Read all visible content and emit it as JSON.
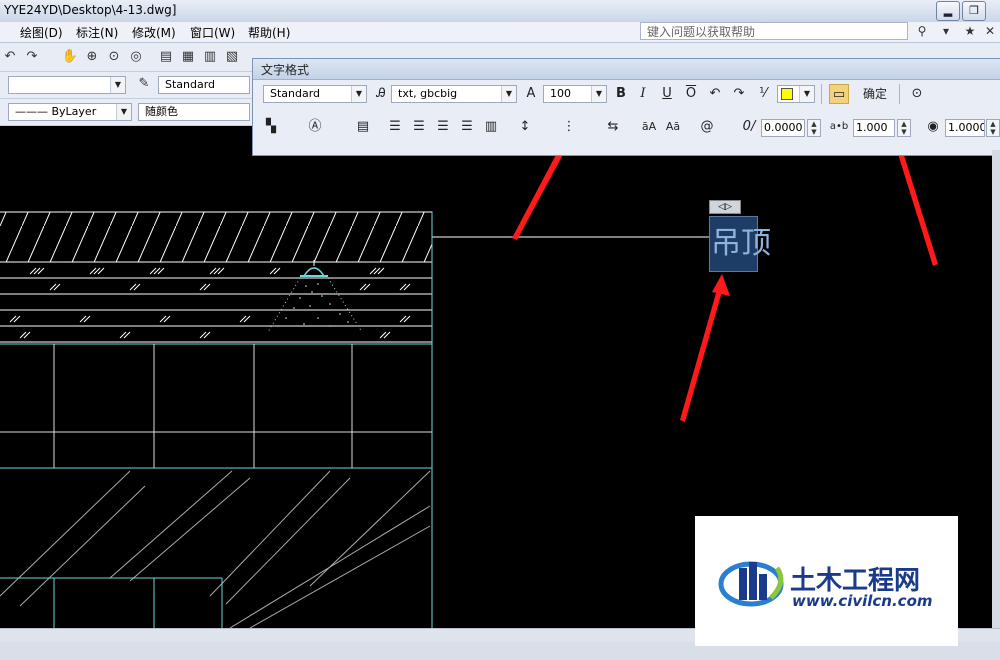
{
  "window": {
    "title": "YYE24YD\\Desktop\\4-13.dwg]",
    "min": "▂",
    "restore": "❐"
  },
  "menu": {
    "items": [
      {
        "label": "绘图(D)"
      },
      {
        "label": "标注(N)"
      },
      {
        "label": "修改(M)"
      },
      {
        "label": "窗口(W)"
      },
      {
        "label": "帮助(H)"
      }
    ],
    "help_placeholder": "键入问题以获取帮助"
  },
  "toolbar": {
    "text_style": "Standard",
    "linetype": "ByLayer",
    "color": "随颜色"
  },
  "text_format": {
    "title": "文字格式",
    "style": "Standard",
    "font": "txt, gbcbig",
    "height": "100",
    "ok_label": "确定",
    "oblique": "0.0000",
    "tracking": "1.000",
    "width_factor": "1.0000"
  },
  "drawing": {
    "label": "吊顶",
    "handle": "◁▷"
  },
  "watermark": {
    "name": "土木工程网",
    "url": "www.civilcn.com"
  },
  "colors": {
    "background": "#000000",
    "lines": "#ffffff",
    "cyan": "#6fd8d8",
    "arrow": "#ff1a1a"
  }
}
